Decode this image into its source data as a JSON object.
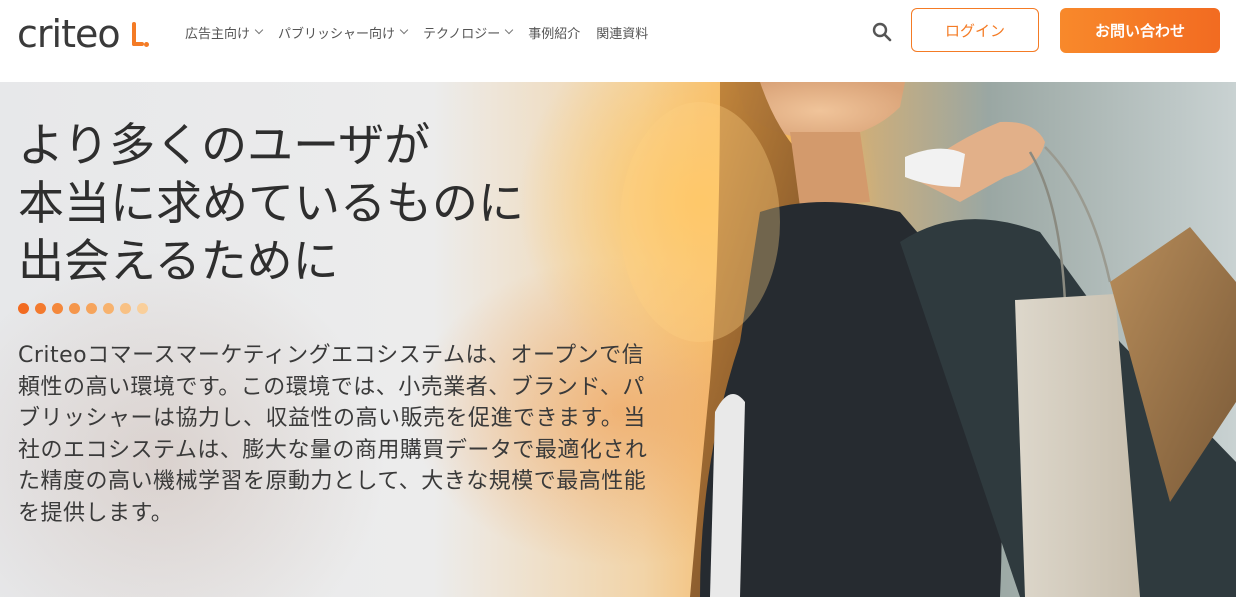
{
  "header": {
    "logo_text": "criteo",
    "nav": [
      {
        "label": "広告主向け",
        "has_dropdown": true
      },
      {
        "label": "パブリッシャー向け",
        "has_dropdown": true
      },
      {
        "label": "テクノロジー",
        "has_dropdown": true
      },
      {
        "label": "事例紹介",
        "has_dropdown": false
      },
      {
        "label": "関連資料",
        "has_dropdown": false
      }
    ],
    "search_icon": "search-icon",
    "login_label": "ログイン",
    "contact_label": "お問い合わせ"
  },
  "hero": {
    "headline_lines": [
      "より多くのユーザが",
      "本当に求めているものに",
      "出会えるために"
    ],
    "description": "Criteoコマースマーケティングエコシステムは、オープンで信頼性の高い環境です。この環境では、小売業者、ブランド、パブリッシャーは協力し、収益性の高い販売を促進できます。当社のエコシステムは、膨大な量の商用購買データで最適化された精度の高い機械学習を原動力として、大きな規模で最高性能を提供します。",
    "dot_colors": [
      "#f26b21",
      "#f37a2e",
      "#f4883c",
      "#f5964b",
      "#f6a45c",
      "#f7b26e",
      "#f8c184",
      "#f9cf9b"
    ]
  },
  "colors": {
    "brand_orange": "#f47b25",
    "text_dark": "#2e2e2e"
  }
}
